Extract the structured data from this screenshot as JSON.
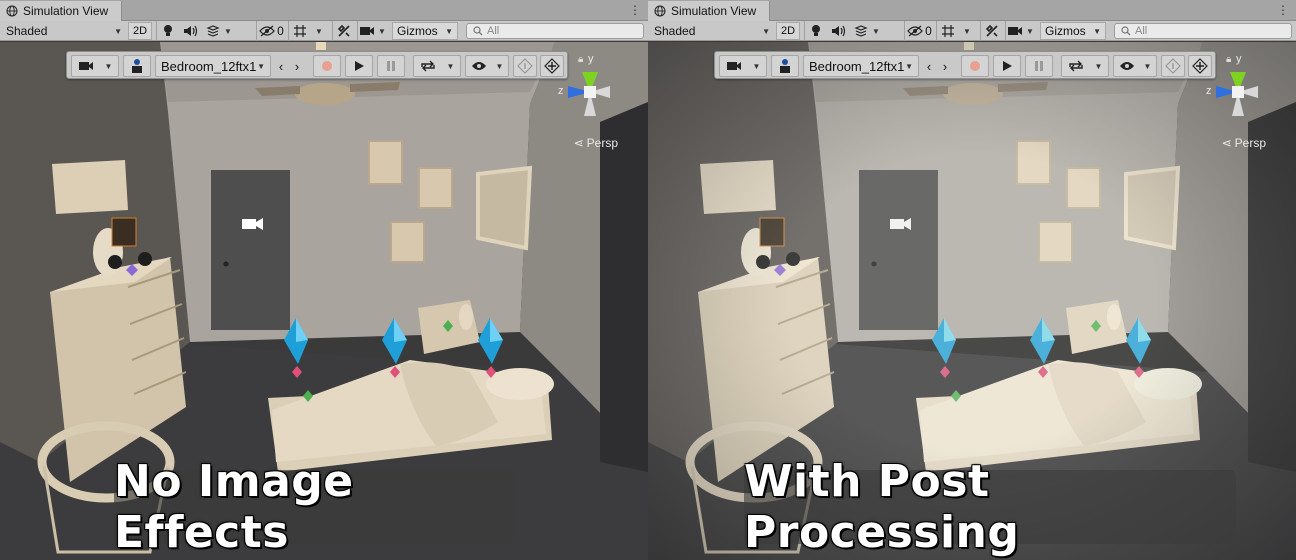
{
  "panels": [
    {
      "tab_title": "Simulation View",
      "draw_mode": "Shaded",
      "btn_2d": "2D",
      "hidden_count": "0",
      "gizmos": "Gizmos",
      "search_placeholder": "All",
      "scene_name": "Bedroom_12ftx1",
      "persp_label": "Persp",
      "caption": "No Image Effects"
    },
    {
      "tab_title": "Simulation View",
      "draw_mode": "Shaded",
      "btn_2d": "2D",
      "hidden_count": "0",
      "gizmos": "Gizmos",
      "search_placeholder": "All",
      "scene_name": "Bedroom_12ftx1",
      "persp_label": "Persp",
      "caption": "With Post Processing"
    }
  ],
  "gizmo_axes": {
    "y": "y",
    "z": "z"
  },
  "colors": {
    "axis_y": "#7ed321",
    "axis_z": "#2f6fe0",
    "diamond_cyan": "#1e9fd8",
    "marker_pink": "#e0507a",
    "marker_green": "#4caf50",
    "marker_purple": "#8a6ad8"
  },
  "icons": [
    "globe-icon",
    "more-vert-icon",
    "light-icon",
    "audio-icon",
    "effects-icon",
    "visibility-icon",
    "grid-icon",
    "tools-icon",
    "camera-icon",
    "search-icon",
    "person-icon",
    "prev-icon",
    "next-icon",
    "record-icon",
    "play-icon",
    "pause-icon",
    "loop-icon",
    "eye-icon",
    "info-icon",
    "target-icon",
    "lock-icon"
  ]
}
